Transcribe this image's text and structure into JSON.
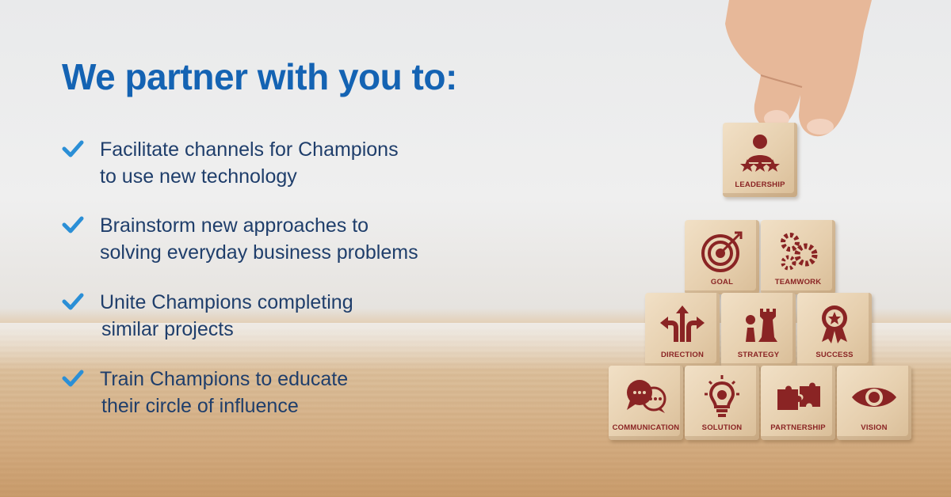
{
  "headline": "We partner with you to:",
  "items": [
    {
      "line1": "Facilitate channels for Champions",
      "line2": "to use new technology"
    },
    {
      "line1": "Brainstorm new approaches to",
      "line2": "solving everyday business problems"
    },
    {
      "line1": "Unite Champions completing",
      "line2": "similar projects"
    },
    {
      "line1": "Train Champions to educate",
      "line2": "their circle of influence"
    }
  ],
  "blocks": {
    "leadership": "LEADERSHIP",
    "goal": "GOAL",
    "teamwork": "TEAMWORK",
    "direction": "DIRECTION",
    "strategy": "STRATEGY",
    "success": "SUCCESS",
    "communication": "COMMUNICATION",
    "solution": "SOLUTION",
    "partnership": "PARTNERSHIP",
    "vision": "VISION"
  },
  "colors": {
    "headline": "#1463b3",
    "body_text": "#1f3e6b",
    "check": "#2b8fd6",
    "icon": "#8a2424"
  }
}
